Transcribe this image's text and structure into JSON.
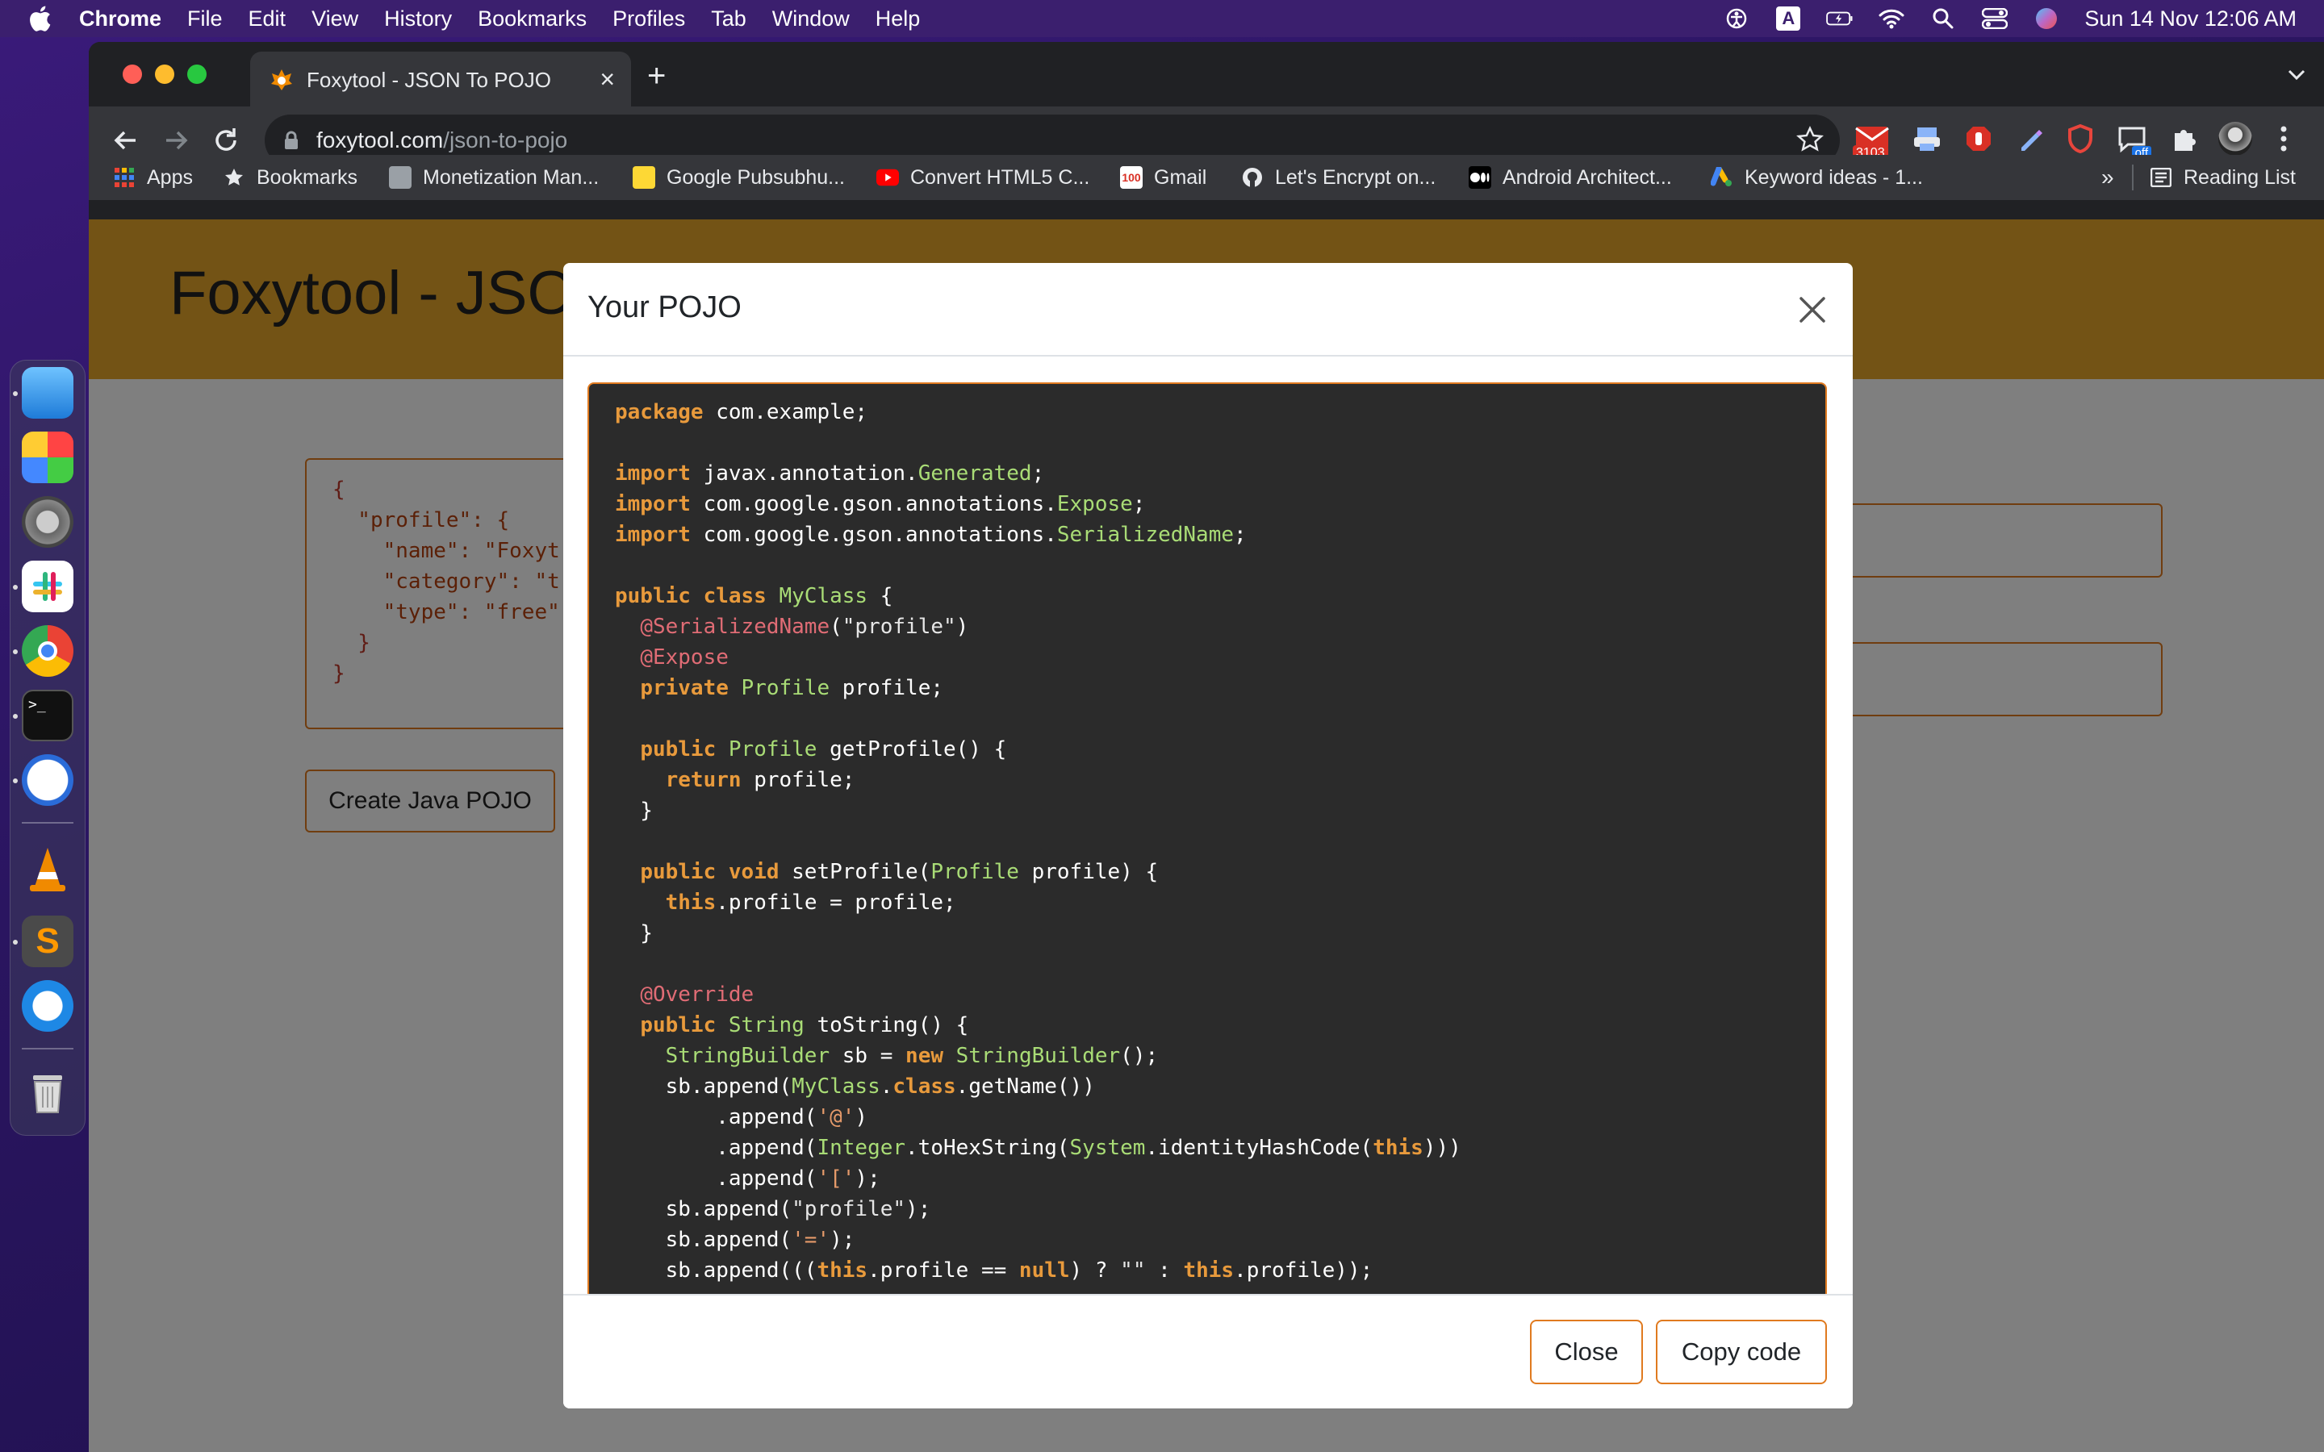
{
  "menubar": {
    "app_name": "Chrome",
    "items": [
      "File",
      "Edit",
      "View",
      "History",
      "Bookmarks",
      "Profiles",
      "Tab",
      "Window",
      "Help"
    ],
    "clock": "Sun 14 Nov  12:06 AM",
    "input_source": "A"
  },
  "browser": {
    "tab": {
      "title": "Foxytool - JSON To POJO"
    },
    "address": {
      "domain": "foxytool.com",
      "path": "/json-to-pojo"
    },
    "extension_badge": "3103",
    "extension_badge_off": "off",
    "bookmarks": [
      {
        "label": "Apps",
        "icon": "apps-grid-icon"
      },
      {
        "label": "Bookmarks",
        "icon": "star-icon"
      },
      {
        "label": "Monetization Man...",
        "icon": "page-icon"
      },
      {
        "label": "Google Pubsubhu...",
        "icon": "folder-yellow-icon"
      },
      {
        "label": "Convert HTML5 C...",
        "icon": "youtube-icon"
      },
      {
        "label": "Gmail",
        "icon": "gmail-icon"
      },
      {
        "label": "Let's Encrypt on...",
        "icon": "github-icon"
      },
      {
        "label": "Android Architect...",
        "icon": "medium-icon"
      },
      {
        "label": "Keyword ideas - 1...",
        "icon": "google-ads-icon"
      }
    ],
    "overflow": "»",
    "reading_list": "Reading List"
  },
  "page": {
    "title": "Foxytool - JSON To POJO",
    "json_lines": [
      "{",
      "  \"profile\": {",
      "    \"name\": \"Foxyt",
      "    \"category\": \"t",
      "    \"type\": \"free\"",
      "  }",
      "}"
    ],
    "create_button": "Create Java POJO"
  },
  "modal": {
    "title": "Your POJO",
    "close_label": "Close",
    "copy_label": "Copy code",
    "code_lines": [
      [
        [
          "kw",
          "package"
        ],
        [
          "pl",
          " com.example;"
        ]
      ],
      [],
      [
        [
          "kw",
          "import"
        ],
        [
          "pl",
          " javax.annotation."
        ],
        [
          "ty",
          "Generated"
        ],
        [
          "pl",
          ";"
        ]
      ],
      [
        [
          "kw",
          "import"
        ],
        [
          "pl",
          " com.google.gson.annotations."
        ],
        [
          "ty",
          "Expose"
        ],
        [
          "pl",
          ";"
        ]
      ],
      [
        [
          "kw",
          "import"
        ],
        [
          "pl",
          " com.google.gson.annotations."
        ],
        [
          "ty",
          "SerializedName"
        ],
        [
          "pl",
          ";"
        ]
      ],
      [],
      [
        [
          "kw",
          "public class"
        ],
        [
          "pl",
          " "
        ],
        [
          "ty",
          "MyClass"
        ],
        [
          "pl",
          " {"
        ]
      ],
      [
        [
          "pl",
          "  "
        ],
        [
          "an",
          "@SerializedName"
        ],
        [
          "pl",
          "("
        ],
        [
          "st",
          "\"profile\""
        ],
        [
          "pl",
          ")"
        ]
      ],
      [
        [
          "pl",
          "  "
        ],
        [
          "an",
          "@Expose"
        ]
      ],
      [
        [
          "pl",
          "  "
        ],
        [
          "kw",
          "private"
        ],
        [
          "pl",
          " "
        ],
        [
          "ty",
          "Profile"
        ],
        [
          "pl",
          " profile;"
        ]
      ],
      [],
      [
        [
          "pl",
          "  "
        ],
        [
          "kw",
          "public"
        ],
        [
          "pl",
          " "
        ],
        [
          "ty",
          "Profile"
        ],
        [
          "pl",
          " getProfile() {"
        ]
      ],
      [
        [
          "pl",
          "    "
        ],
        [
          "kw",
          "return"
        ],
        [
          "pl",
          " profile;"
        ]
      ],
      [
        [
          "pl",
          "  }"
        ]
      ],
      [],
      [
        [
          "pl",
          "  "
        ],
        [
          "kw",
          "public void"
        ],
        [
          "pl",
          " setProfile("
        ],
        [
          "ty",
          "Profile"
        ],
        [
          "pl",
          " profile) {"
        ]
      ],
      [
        [
          "pl",
          "    "
        ],
        [
          "kw",
          "this"
        ],
        [
          "pl",
          ".profile = profile;"
        ]
      ],
      [
        [
          "pl",
          "  }"
        ]
      ],
      [],
      [
        [
          "pl",
          "  "
        ],
        [
          "an",
          "@Override"
        ]
      ],
      [
        [
          "pl",
          "  "
        ],
        [
          "kw",
          "public"
        ],
        [
          "pl",
          " "
        ],
        [
          "ty",
          "String"
        ],
        [
          "pl",
          " toString() {"
        ]
      ],
      [
        [
          "pl",
          "    "
        ],
        [
          "ty",
          "StringBuilder"
        ],
        [
          "pl",
          " sb = "
        ],
        [
          "kw",
          "new"
        ],
        [
          "pl",
          " "
        ],
        [
          "ty",
          "StringBuilder"
        ],
        [
          "pl",
          "();"
        ]
      ],
      [
        [
          "pl",
          "    sb.append("
        ],
        [
          "ty",
          "MyClass"
        ],
        [
          "pl",
          "."
        ],
        [
          "kw",
          "class"
        ],
        [
          "pl",
          ".getName())"
        ]
      ],
      [
        [
          "pl",
          "        .append("
        ],
        [
          "sq",
          "'@'"
        ],
        [
          "pl",
          ")"
        ]
      ],
      [
        [
          "pl",
          "        .append("
        ],
        [
          "ty",
          "Integer"
        ],
        [
          "pl",
          ".toHexString("
        ],
        [
          "ty",
          "System"
        ],
        [
          "pl",
          ".identityHashCode("
        ],
        [
          "kw",
          "this"
        ],
        [
          "pl",
          ")))"
        ]
      ],
      [
        [
          "pl",
          "        .append("
        ],
        [
          "sq",
          "'['"
        ],
        [
          "pl",
          ");"
        ]
      ],
      [
        [
          "pl",
          "    sb.append("
        ],
        [
          "st",
          "\"profile\""
        ],
        [
          "pl",
          ");"
        ]
      ],
      [
        [
          "pl",
          "    sb.append("
        ],
        [
          "sq",
          "'='"
        ],
        [
          "pl",
          ");"
        ]
      ],
      [
        [
          "pl",
          "    sb.append((("
        ],
        [
          "kw",
          "this"
        ],
        [
          "pl",
          ".profile == "
        ],
        [
          "kw",
          "null"
        ],
        [
          "pl",
          ") ? "
        ],
        [
          "st",
          "\"\""
        ],
        [
          "pl",
          " : "
        ],
        [
          "kw",
          "this"
        ],
        [
          "pl",
          ".profile));"
        ]
      ]
    ]
  },
  "colors": {
    "accent": "#e07a1f",
    "hero_bg": "#e6a72a",
    "code_bg": "#2b2b2b",
    "keyword": "#e89a3c",
    "type": "#a9dc76",
    "annotation": "#e06c75"
  }
}
